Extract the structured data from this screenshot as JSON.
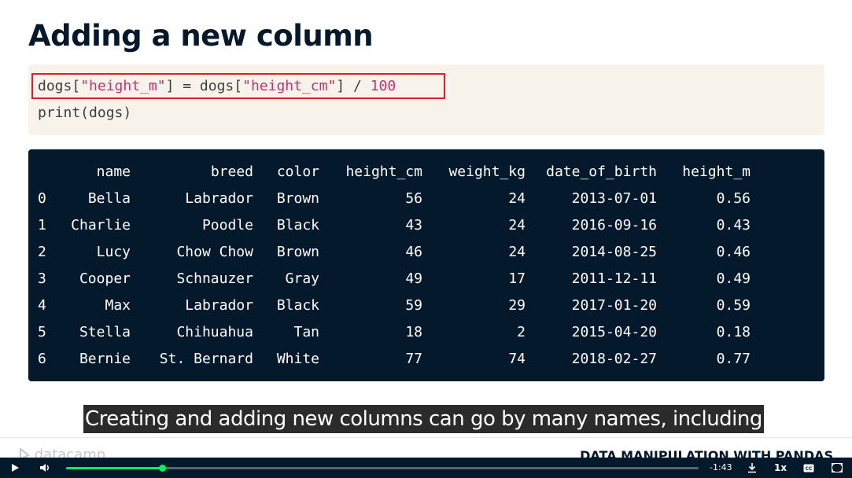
{
  "slide": {
    "title": "Adding a new column",
    "code": {
      "line1": {
        "p1": "dogs[",
        "s1": "\"height_m\"",
        "p2": "] = dogs[",
        "s2": "\"height_cm\"",
        "p3": "] / ",
        "n1": "100"
      },
      "line2": "print(dogs)"
    },
    "output": {
      "headers": [
        "name",
        "breed",
        "color",
        "height_cm",
        "weight_kg",
        "date_of_birth",
        "height_m"
      ],
      "rows": [
        [
          "0",
          "Bella",
          "Labrador",
          "Brown",
          "56",
          "24",
          "2013-07-01",
          "0.56"
        ],
        [
          "1",
          "Charlie",
          "Poodle",
          "Black",
          "43",
          "24",
          "2016-09-16",
          "0.43"
        ],
        [
          "2",
          "Lucy",
          "Chow Chow",
          "Brown",
          "46",
          "24",
          "2014-08-25",
          "0.46"
        ],
        [
          "3",
          "Cooper",
          "Schnauzer",
          "Gray",
          "49",
          "17",
          "2011-12-11",
          "0.49"
        ],
        [
          "4",
          "Max",
          "Labrador",
          "Black",
          "59",
          "29",
          "2017-01-20",
          "0.59"
        ],
        [
          "5",
          "Stella",
          "Chihuahua",
          "Tan",
          "18",
          "2",
          "2015-04-20",
          "0.18"
        ],
        [
          "6",
          "Bernie",
          "St. Bernard",
          "White",
          "77",
          "74",
          "2018-02-27",
          "0.77"
        ]
      ]
    },
    "subtitle": "Creating and adding new columns can go by many names, including",
    "logo_text": "datacamp",
    "course_title": "DATA MANIPULATION WITH PANDAS"
  },
  "player": {
    "time_remaining": "-1:43",
    "speed": "1x",
    "progress_fraction": 0.152
  },
  "colors": {
    "navy": "#05192d",
    "accent_green": "#03ef62",
    "code_bg": "#f7f3eb",
    "string_color": "#c7306f",
    "highlight_border": "#e01e2b"
  }
}
